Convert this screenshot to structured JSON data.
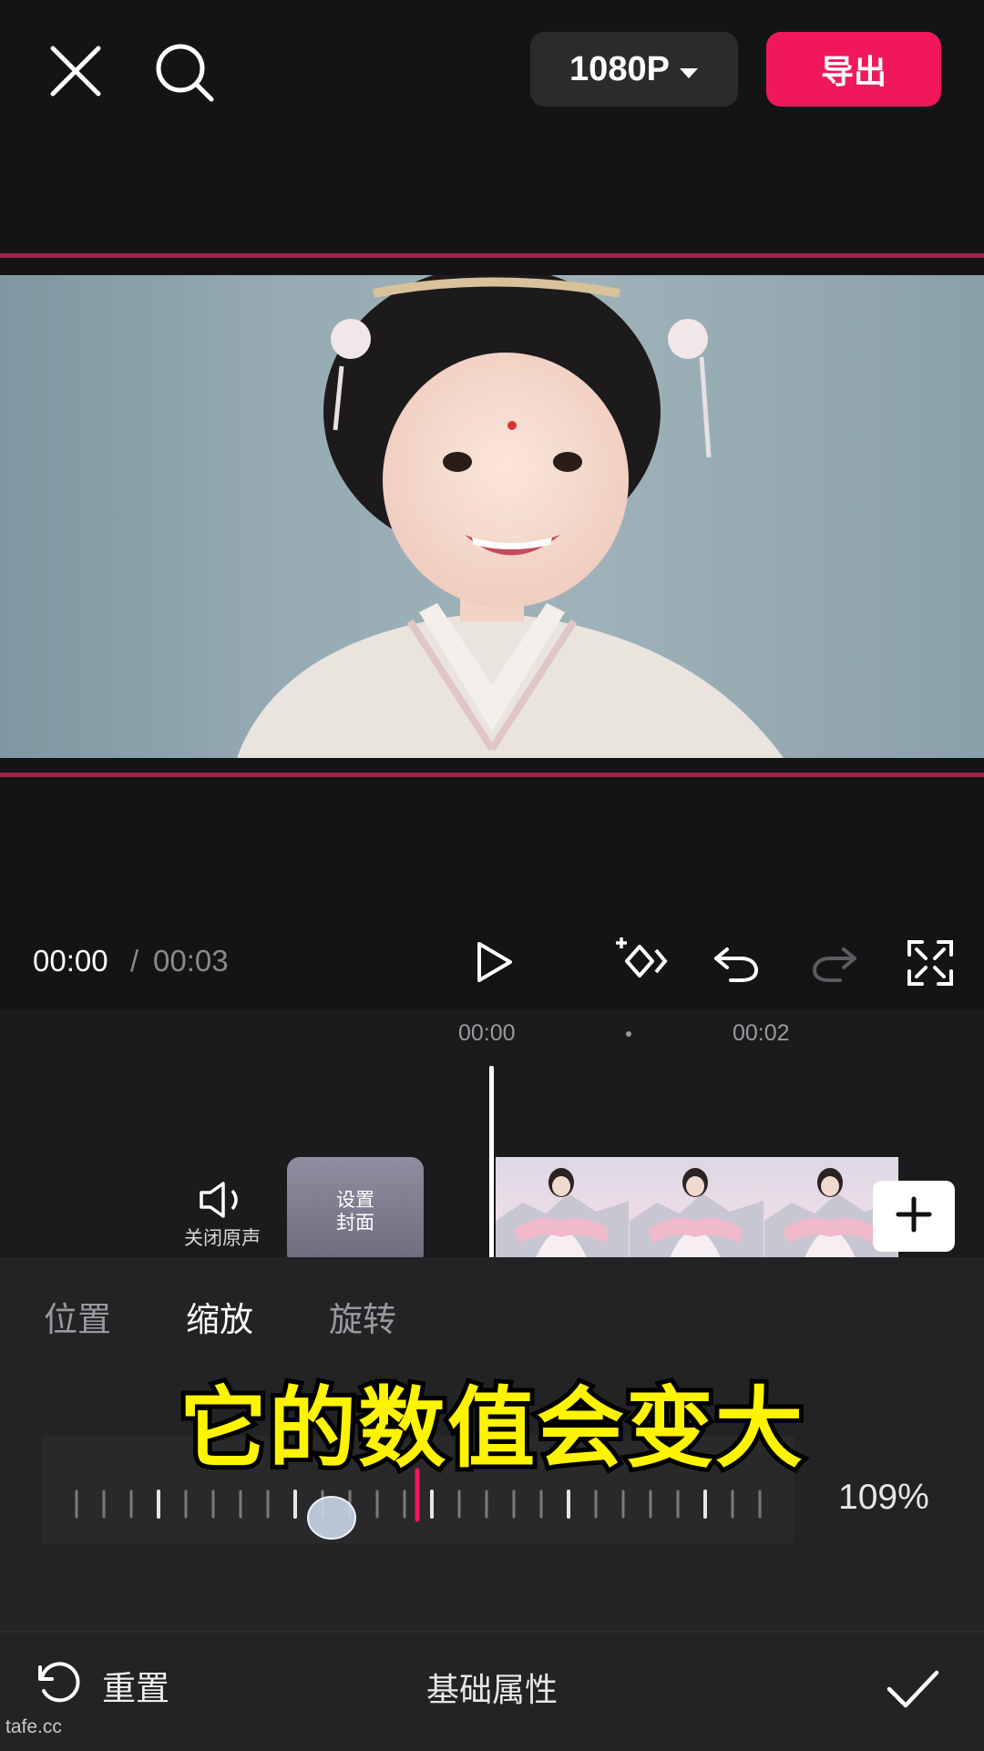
{
  "toolbar": {
    "close_icon": "close-icon",
    "search_icon": "search-icon",
    "resolution": "1080P",
    "export_label": "导出"
  },
  "player": {
    "current_time": "00:00",
    "separator": "/",
    "total_time": "00:03"
  },
  "timeline": {
    "ruler_labels": [
      "00:00",
      "00:02"
    ],
    "mute_label": "关闭原声",
    "cover_label": "设置封面"
  },
  "panel": {
    "tabs": [
      {
        "label": "位置",
        "active": false
      },
      {
        "label": "缩放",
        "active": true
      },
      {
        "label": "旋转",
        "active": false
      }
    ],
    "caption": "它的数值会变大",
    "scale_value": "109%",
    "scale_percent": 109,
    "reset_label": "重置",
    "section_title": "基础属性"
  },
  "watermark": "tafe.cc",
  "colors": {
    "accent": "#f0185b",
    "caption": "#fff400",
    "background": "#141416",
    "panel": "#232325"
  }
}
